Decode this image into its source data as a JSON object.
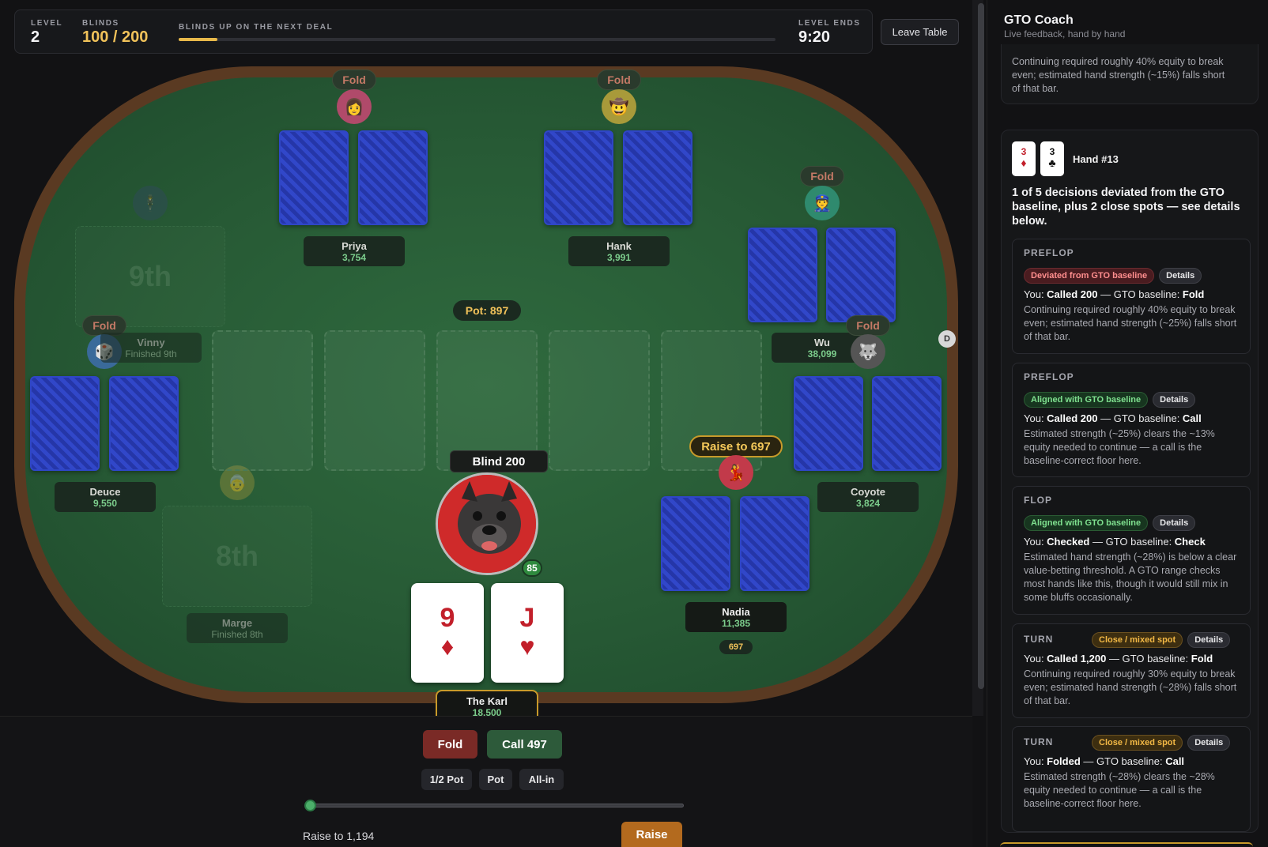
{
  "top": {
    "level_label": "LEVEL",
    "level_value": "2",
    "blinds_label": "BLINDS",
    "blinds_value": "100 / 200",
    "progress_label": "BLINDS UP ON THE NEXT DEAL",
    "progress_fraction": 0.065,
    "ends_label": "LEVEL ENDS",
    "ends_value": "9:20",
    "leave_label": "Leave Table"
  },
  "players": {
    "priya": {
      "name": "Priya",
      "stack": "3,754",
      "action": "Fold"
    },
    "hank": {
      "name": "Hank",
      "stack": "3,991",
      "action": "Fold"
    },
    "wu": {
      "name": "Wu",
      "stack": "38,099",
      "action": "Fold"
    },
    "vinny": {
      "name": "Vinny",
      "status": "Finished 9th",
      "action": "Fold"
    },
    "coyote": {
      "name": "Coyote",
      "stack": "3,824",
      "action": "Fold"
    },
    "deuce": {
      "name": "Deuce",
      "stack": "9,550"
    },
    "marge": {
      "name": "Marge",
      "status": "Finished 8th"
    },
    "nadia": {
      "name": "Nadia",
      "stack": "11,385",
      "action": "Raise to 697",
      "bet": "697"
    },
    "hero": {
      "name": "The Karl",
      "stack": "18,500",
      "action": "Blind 200",
      "timer": "85",
      "cards": [
        {
          "rank": "9",
          "suit": "♦"
        },
        {
          "rank": "J",
          "suit": "♥"
        }
      ]
    }
  },
  "table": {
    "pot": "Pot: 897",
    "bust_9": "9th",
    "bust_8": "8th",
    "dealer": "D"
  },
  "controls": {
    "fold": "Fold",
    "call": "Call 497",
    "half_pot": "1/2 Pot",
    "pot": "Pot",
    "allin": "All-in",
    "raise_text": "Raise to 1,194",
    "raise_btn": "Raise",
    "slider_fraction": 0.0
  },
  "coach": {
    "title": "GTO Coach",
    "subtitle": "Live feedback, hand by hand",
    "prev_text": "Continuing required roughly 40% equity to break even; estimated hand strength (~15%) falls short of that bar.",
    "hand_title": "Hand #13",
    "hand_cards": [
      {
        "rank": "3",
        "suit": "♦"
      },
      {
        "rank": "3",
        "suit": "♣"
      }
    ],
    "summary": "1 of 5 decisions deviated from the GTO baseline, plus 2 close spots — see details below.",
    "decisions": [
      {
        "street": "PREFLOP",
        "pill": "Deviated from GTO baseline",
        "kind": "dev",
        "details": "Details",
        "you_action": "Called 200",
        "baseline": "Fold",
        "text": "Continuing required roughly 40% equity to break even; estimated hand strength (~25%) falls short of that bar."
      },
      {
        "street": "PREFLOP",
        "pill": "Aligned with GTO baseline",
        "kind": "ok",
        "details": "Details",
        "you_action": "Called 200",
        "baseline": "Call",
        "text": "Estimated strength (~25%) clears the ~13% equity needed to continue — a call is the baseline-correct floor here."
      },
      {
        "street": "FLOP",
        "pill": "Aligned with GTO baseline",
        "kind": "ok",
        "details": "Details",
        "you_action": "Checked",
        "baseline": "Check",
        "text": "Estimated hand strength (~28%) is below a clear value-betting threshold. A GTO range checks most hands like this, though it would still mix in some bluffs occasionally."
      },
      {
        "street": "TURN",
        "pill": "Close / mixed spot",
        "kind": "mix",
        "details": "Details",
        "you_action": "Called 1,200",
        "baseline": "Fold",
        "text": "Continuing required roughly 30% equity to break even; estimated hand strength (~28%) falls short of that bar."
      },
      {
        "street": "TURN",
        "pill": "Close / mixed spot",
        "kind": "mix",
        "details": "Details",
        "you_action": "Folded",
        "baseline": "Call",
        "text": "Estimated strength (~28%) clears the ~28% equity needed to continue — a call is the baseline-correct floor here."
      }
    ],
    "you_prefix": "You: ",
    "baseline_prefix": " — GTO baseline: "
  }
}
